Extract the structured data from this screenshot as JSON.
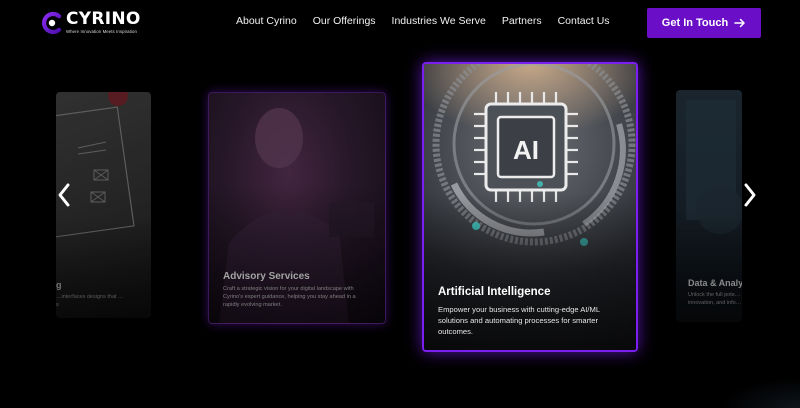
{
  "brand": {
    "name": "CYRINO",
    "tagline": "Where Innovation Meets Inspiration",
    "accent": "#6a0fc7"
  },
  "nav": {
    "items": [
      {
        "label": "About Cyrino"
      },
      {
        "label": "Our Offerings"
      },
      {
        "label": "Industries We Serve"
      },
      {
        "label": "Partners"
      },
      {
        "label": "Contact Us"
      }
    ]
  },
  "cta": {
    "label": "Get In Touch",
    "icon": "arrow-right-icon"
  },
  "carousel": {
    "prev_icon": "chevron-left-icon",
    "next_icon": "chevron-right-icon",
    "cards": [
      {
        "title": "g",
        "desc": "…interfaces designs that …s"
      },
      {
        "title": "Advisory Services",
        "desc": "Craft a strategic vision for your digital landscape with Cyrino's expert guidance, helping you stay ahead in a rapidly evolving market."
      },
      {
        "title": "Artificial Intelligence",
        "desc": "Empower your business with cutting-edge AI/ML solutions and automating processes for smarter outcomes."
      },
      {
        "title": "Data & Analy",
        "desc": "Unlock the full pote… innovation, and info…"
      }
    ]
  }
}
